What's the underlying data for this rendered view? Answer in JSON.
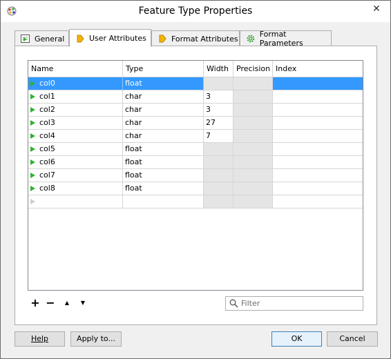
{
  "window": {
    "title": "Feature Type Properties"
  },
  "tabs": [
    {
      "label": "General",
      "icon": "general-tab-icon"
    },
    {
      "label": "User Attributes",
      "icon": "tag-icon"
    },
    {
      "label": "Format Attributes",
      "icon": "tag-icon"
    },
    {
      "label": "Format Parameters",
      "icon": "gear-icon"
    }
  ],
  "active_tab": "User Attributes",
  "table": {
    "columns": [
      "Name",
      "Type",
      "Width",
      "Precision",
      "Index"
    ],
    "rows": [
      {
        "name": "col0",
        "type": "float",
        "width": "",
        "precision": "",
        "index": "",
        "selected": true
      },
      {
        "name": "col1",
        "type": "char",
        "width": "3",
        "precision": "",
        "index": ""
      },
      {
        "name": "col2",
        "type": "char",
        "width": "3",
        "precision": "",
        "index": ""
      },
      {
        "name": "col3",
        "type": "char",
        "width": "27",
        "precision": "",
        "index": ""
      },
      {
        "name": "col4",
        "type": "char",
        "width": "7",
        "precision": "",
        "index": ""
      },
      {
        "name": "col5",
        "type": "float",
        "width": "",
        "precision": "",
        "index": ""
      },
      {
        "name": "col6",
        "type": "float",
        "width": "",
        "precision": "",
        "index": ""
      },
      {
        "name": "col7",
        "type": "float",
        "width": "",
        "precision": "",
        "index": ""
      },
      {
        "name": "col8",
        "type": "float",
        "width": "",
        "precision": "",
        "index": ""
      }
    ]
  },
  "toolbar": {
    "add": "+",
    "remove": "−",
    "up": "▲",
    "down": "▼"
  },
  "filter": {
    "placeholder": "Filter"
  },
  "buttons": {
    "help": "Help",
    "apply": "Apply to...",
    "ok": "OK",
    "cancel": "Cancel"
  },
  "colors": {
    "selection": "#3399ff",
    "arrow": "#2fb12f",
    "disabled_cell": "#e5e5e5"
  }
}
